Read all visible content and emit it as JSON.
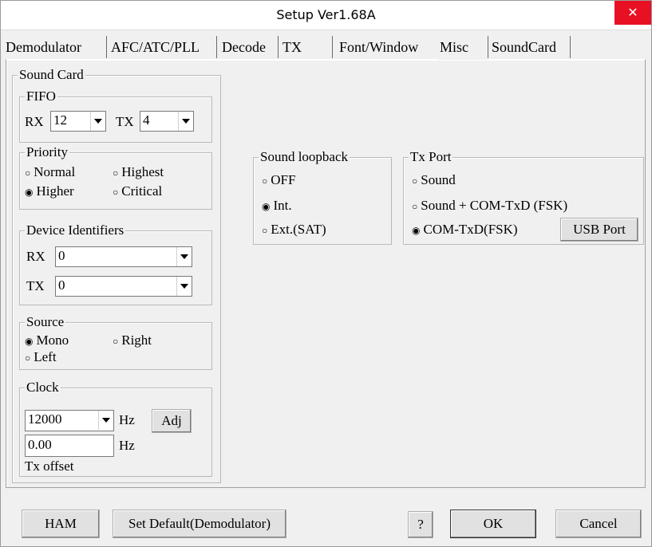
{
  "window": {
    "title": "Setup Ver1.68A",
    "close_glyph": "✕"
  },
  "tabs": [
    {
      "label": "Demodulator"
    },
    {
      "label": "AFC/ATC/PLL"
    },
    {
      "label": "Decode"
    },
    {
      "label": "TX"
    },
    {
      "label": "Font/Window"
    },
    {
      "label": "Misc"
    },
    {
      "label": "SoundCard"
    }
  ],
  "active_tab": "Misc",
  "sound_card": {
    "label": "Sound Card",
    "fifo": {
      "label": "FIFO",
      "rx_label": "RX",
      "rx_value": "12",
      "tx_label": "TX",
      "tx_value": "4"
    },
    "priority": {
      "label": "Priority",
      "normal": "Normal",
      "highest": "Highest",
      "higher": "Higher",
      "critical": "Critical",
      "selected": "Higher"
    },
    "device": {
      "label": "Device Identifiers",
      "rx_label": "RX",
      "rx_value": "0",
      "tx_label": "TX",
      "tx_value": "0"
    },
    "source": {
      "label": "Source",
      "mono": "Mono",
      "right": "Right",
      "left": "Left",
      "selected": "Mono"
    },
    "clock": {
      "label": "Clock",
      "value": "12000",
      "hz1": "Hz",
      "adj": "Adj",
      "offset_value": "0.00",
      "hz2": "Hz",
      "offset_label": "Tx offset"
    }
  },
  "loopback": {
    "label": "Sound loopback",
    "off": "OFF",
    "int": "Int.",
    "ext": "Ext.(SAT)",
    "selected": "Int."
  },
  "txport": {
    "label": "Tx Port",
    "sound": "Sound",
    "sound_com": "Sound + COM-TxD (FSK)",
    "com": "COM-TxD(FSK)",
    "usb": "USB Port",
    "selected": "COM-TxD(FSK)"
  },
  "bottom": {
    "ham": "HAM",
    "set_default": "Set Default(Demodulator)",
    "help": "?",
    "ok": "OK",
    "cancel": "Cancel"
  },
  "glyphs": {
    "radio_on": "◉",
    "radio_off": "○"
  }
}
